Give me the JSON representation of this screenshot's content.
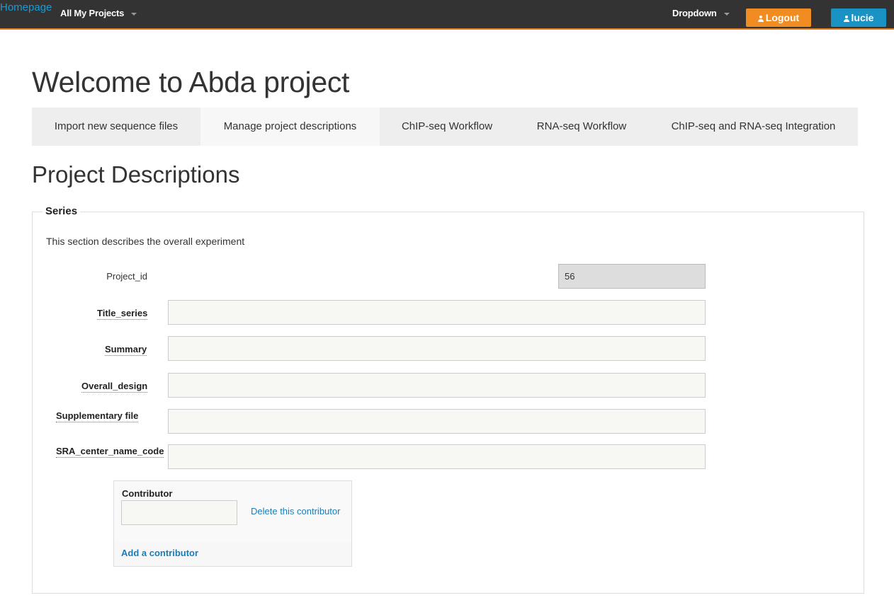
{
  "navbar": {
    "brand": "Homepage",
    "projects_dropdown": "All My Projects",
    "dropdown": "Dropdown",
    "logout_label": "Logout",
    "user_label": "lucie",
    "colors": {
      "bar": "#333333",
      "accent_line": "#e67e22",
      "logout": "#f08c22",
      "user": "#1893c4"
    }
  },
  "page": {
    "title": "Welcome to Abda project",
    "tabs": [
      {
        "label": "Import new sequence files",
        "active": false
      },
      {
        "label": "Manage project descriptions",
        "active": true
      },
      {
        "label": "ChIP-seq Workflow",
        "active": false
      },
      {
        "label": "RNA-seq Workflow",
        "active": false
      },
      {
        "label": "ChIP-seq and RNA-seq Integration",
        "active": false
      }
    ],
    "section_title": "Project Descriptions"
  },
  "series": {
    "legend": "Series",
    "description": "This section describes the overall experiment",
    "project_id_label": "Project_id",
    "project_id_value": "56",
    "fields": [
      {
        "label": "Title_series",
        "value": ""
      },
      {
        "label": "Summary",
        "value": ""
      },
      {
        "label": "Overall_design",
        "value": ""
      },
      {
        "label": "Supplementary file",
        "value": ""
      },
      {
        "label": "SRA_center_name_code",
        "value": ""
      }
    ],
    "contributor": {
      "title": "Contributor",
      "value": "",
      "delete_label": "Delete this contributor",
      "add_label": "Add a contributor"
    }
  }
}
